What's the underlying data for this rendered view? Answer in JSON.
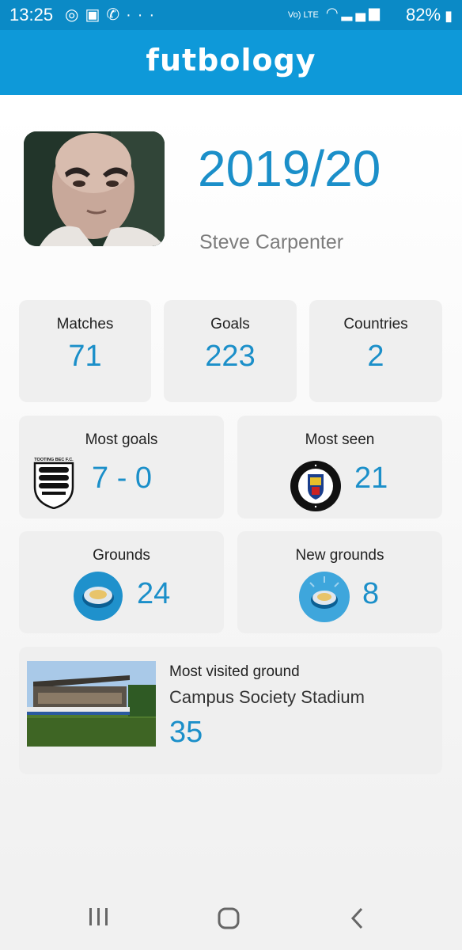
{
  "status_bar": {
    "time": "13:25",
    "notification_icons": [
      "instagram-icon",
      "speaker-icon",
      "whatsapp-icon"
    ],
    "more": "···",
    "network": "Vo) LTE",
    "battery": "82%"
  },
  "app": {
    "title": "futbology"
  },
  "profile": {
    "season": "2019/20",
    "name": "Steve Carpenter"
  },
  "stats": [
    {
      "label": "Matches",
      "value": "71"
    },
    {
      "label": "Goals",
      "value": "223"
    },
    {
      "label": "Countries",
      "value": "2"
    }
  ],
  "most_goals": {
    "label": "Most goals",
    "value": "7 - 0",
    "crest_text": "TOOTING BEC F.C."
  },
  "most_seen": {
    "label": "Most seen",
    "value": "21",
    "crest_text": "TOOTING & MITCHAM UNITED FOOTBALL CLUB"
  },
  "grounds": {
    "label": "Grounds",
    "value": "24"
  },
  "new_grounds": {
    "label": "New grounds",
    "value": "8"
  },
  "most_visited": {
    "label": "Most visited ground",
    "name": "Campus Society Stadium",
    "value": "35"
  },
  "colors": {
    "brand": "#0e99d9",
    "accent": "#1b8fc9",
    "card": "#efefef"
  }
}
